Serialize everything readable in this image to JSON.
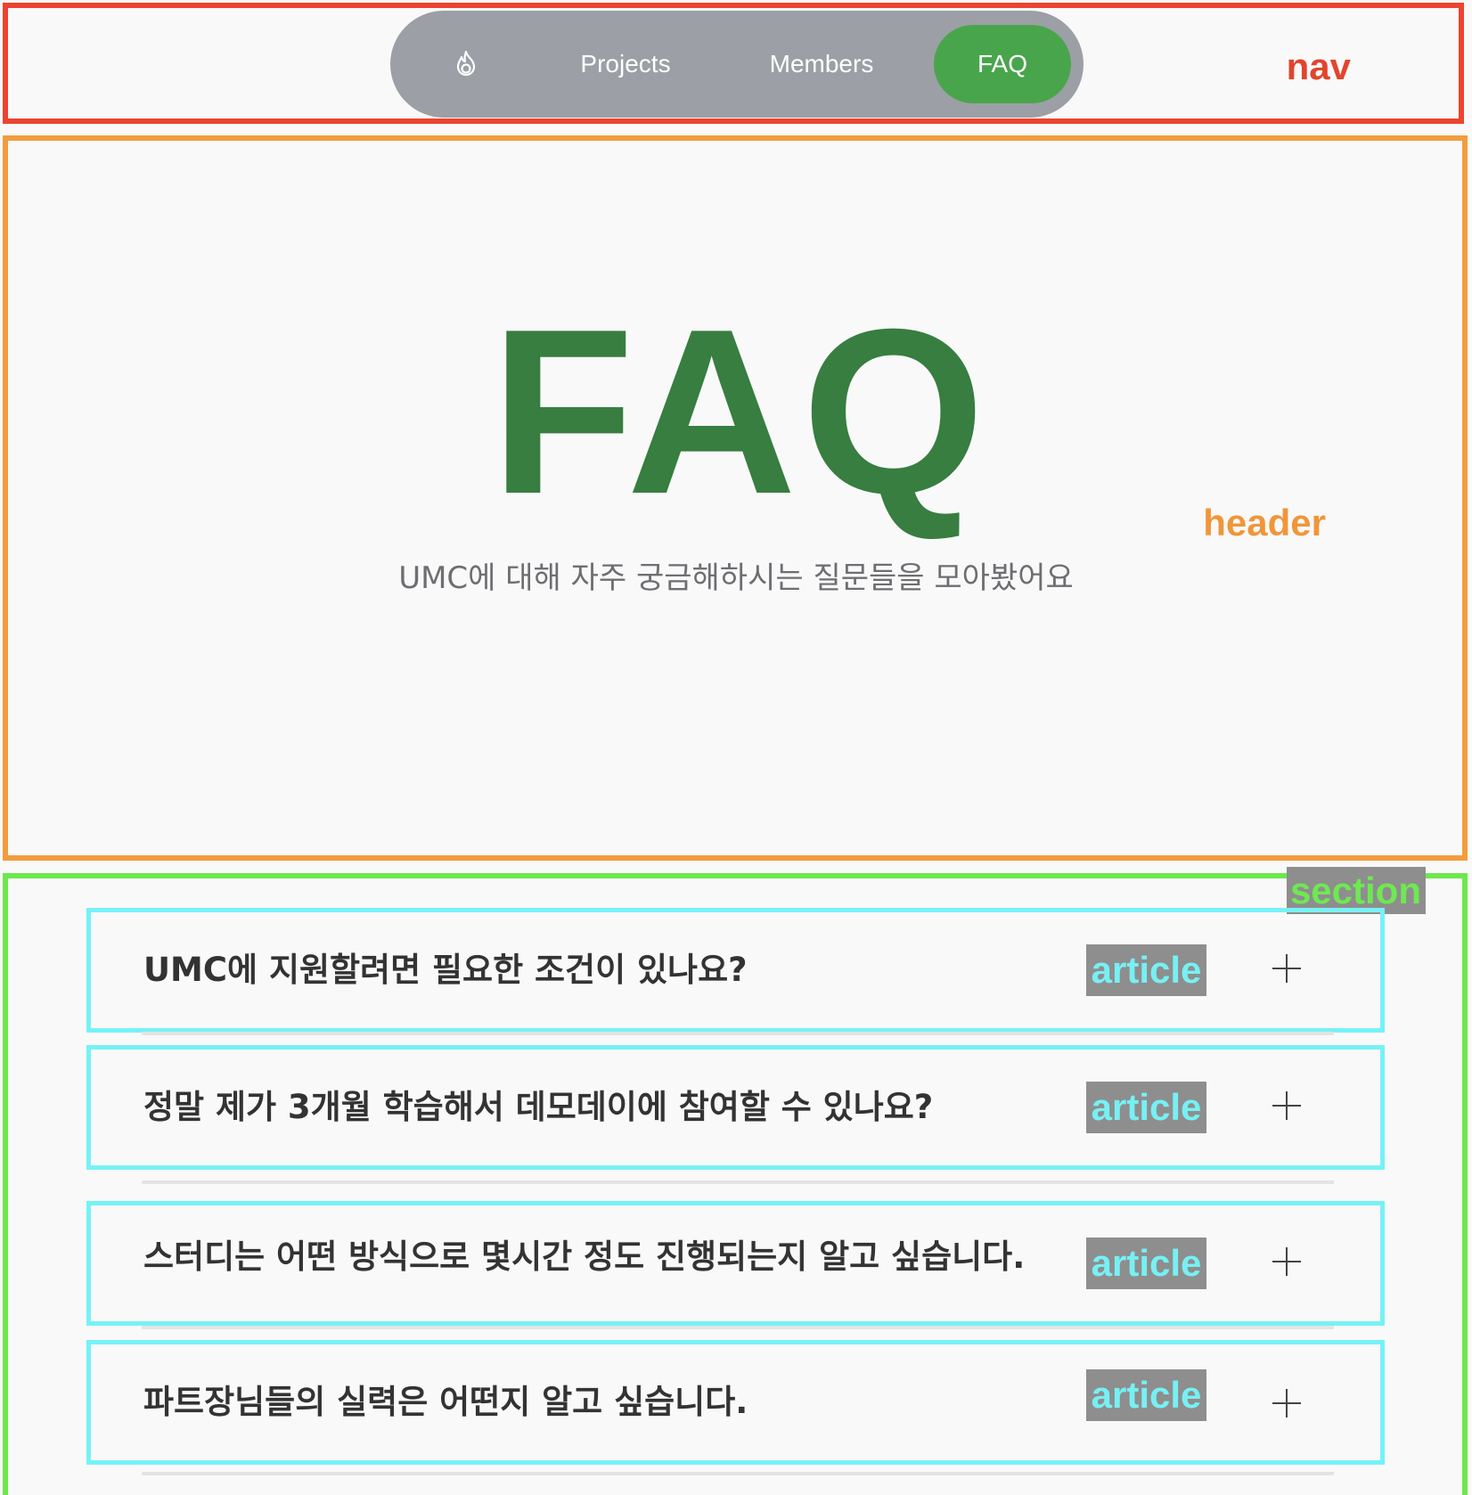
{
  "labels": {
    "nav": "nav",
    "header": "header",
    "section": "section",
    "article": "article"
  },
  "nav": {
    "logo_icon": "flame-icon",
    "links": [
      {
        "label": "Projects"
      },
      {
        "label": "Members"
      },
      {
        "label": "FAQ",
        "active": true
      }
    ],
    "colors": {
      "pill": "#9c9fa5",
      "active": "#49a54c"
    }
  },
  "header": {
    "title": "FAQ",
    "subtitle": "UMC에 대해 자주 궁금해하시는 질문들을 모아봤어요",
    "title_color": "#377e40"
  },
  "faq": {
    "items": [
      {
        "question": "UMC에 지원할려면 필요한 조건이 있나요?"
      },
      {
        "question": "정말 제가 3개월 학습해서 데모데이에 참여할 수 있나요?"
      },
      {
        "question": "스터디는 어떤 방식으로 몇시간 정도 진행되는지 알고 싶습니다."
      },
      {
        "question": "파트장님들의 실력은 어떤지 알고 싶습니다."
      }
    ],
    "expand_icon": "plus-icon"
  }
}
